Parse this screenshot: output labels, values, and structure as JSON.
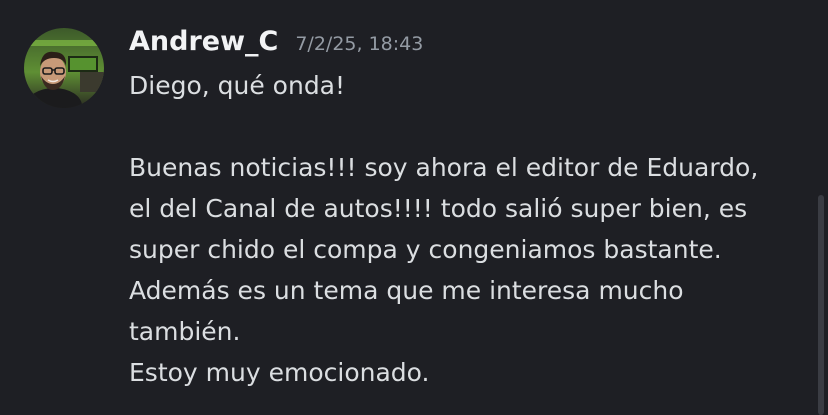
{
  "message": {
    "author": "Andrew_C",
    "timestamp": "7/2/25, 18:43",
    "lines": [
      "Diego, qué onda!",
      "",
      "Buenas noticias!!! soy ahora el editor de Eduardo,",
      "el del Canal de autos!!!! todo salió super bien, es",
      "super chido el compa y congeniamos bastante.",
      "Además es un tema que me interesa mucho",
      "también.",
      "Estoy muy emocionado."
    ]
  },
  "colors": {
    "background": "#1e1f24",
    "author": "#f2f3f5",
    "text": "#dbdee1",
    "timestamp": "#949ba4"
  },
  "icons": {
    "avatar": "user-avatar-photo"
  }
}
